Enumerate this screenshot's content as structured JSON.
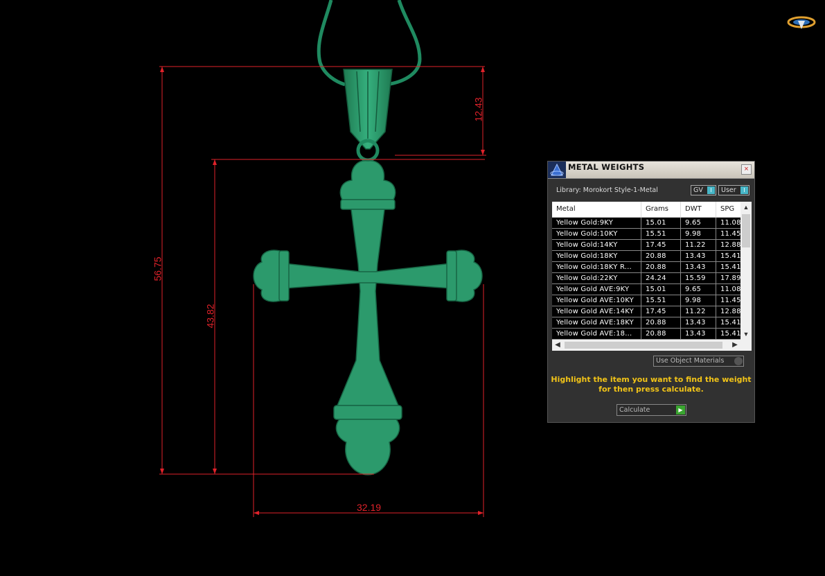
{
  "dimensions": {
    "overall_height": "56.75",
    "cross_height": "43.82",
    "bail_height": "12.43",
    "width": "32.19"
  },
  "panel": {
    "title": "METAL WEIGHTS",
    "close_glyph": "×",
    "library_label": "Library: Morokort Style-1-Metal",
    "gv_label": "GV",
    "user_label": "User",
    "toggle_indicator": "I",
    "columns": [
      "Metal",
      "Grams",
      "DWT",
      "SPG"
    ],
    "rows": [
      [
        "Yellow Gold:9KY",
        "15.01",
        "9.65",
        "11.08"
      ],
      [
        "Yellow Gold:10KY",
        "15.51",
        "9.98",
        "11.45"
      ],
      [
        "Yellow Gold:14KY",
        "17.45",
        "11.22",
        "12.88"
      ],
      [
        "Yellow Gold:18KY",
        "20.88",
        "13.43",
        "15.41"
      ],
      [
        "Yellow Gold:18KY R...",
        "20.88",
        "13.43",
        "15.41"
      ],
      [
        "Yellow Gold:22KY",
        "24.24",
        "15.59",
        "17.89"
      ],
      [
        "Yellow Gold AVE:9KY",
        "15.01",
        "9.65",
        "11.08"
      ],
      [
        "Yellow Gold AVE:10KY",
        "15.51",
        "9.98",
        "11.45"
      ],
      [
        "Yellow Gold AVE:14KY",
        "17.45",
        "11.22",
        "12.88"
      ],
      [
        "Yellow Gold AVE:18KY",
        "20.88",
        "13.43",
        "15.41"
      ],
      [
        "Yellow Gold AVE:18...",
        "20.88",
        "13.43",
        "15.41"
      ]
    ],
    "use_object_materials_label": "Use Object Materials",
    "hint_line1": "Highlight the item you want to find the weight",
    "hint_line2": "for then press calculate.",
    "calculate_label": "Calculate",
    "calculate_glyph": "▶",
    "scroll_up": "▲",
    "scroll_down": "▼",
    "scroll_left": "◀",
    "scroll_right": "▶"
  },
  "colors": {
    "pendant": "#2c9a6c",
    "dimension_lines": "#e0222a",
    "hint_text": "#f2c418",
    "indicator": "#48b7c8"
  },
  "icons": [
    "app-logo-icon",
    "panel-logo-icon",
    "close-icon",
    "calculate-arrow-icon"
  ]
}
